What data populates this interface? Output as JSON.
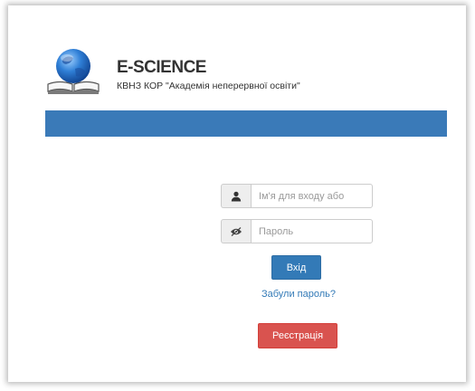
{
  "header": {
    "title": "E-SCIENCE",
    "subtitle": "КВНЗ КОР \"Академія неперервної освіти\"",
    "bar_color": "#3a7ab8",
    "logo_icon": "globe-on-book-icon"
  },
  "login": {
    "username": {
      "icon": "user-icon",
      "placeholder": "Ім'я для входу або",
      "value": ""
    },
    "password": {
      "icon": "eye-icon",
      "placeholder": "Пароль",
      "value": ""
    },
    "submit_label": "Вхід",
    "submit_color": "#337ab7",
    "forgot_link": "Забули пароль?",
    "register_label": "Реєстрація",
    "register_color": "#d9534f"
  }
}
